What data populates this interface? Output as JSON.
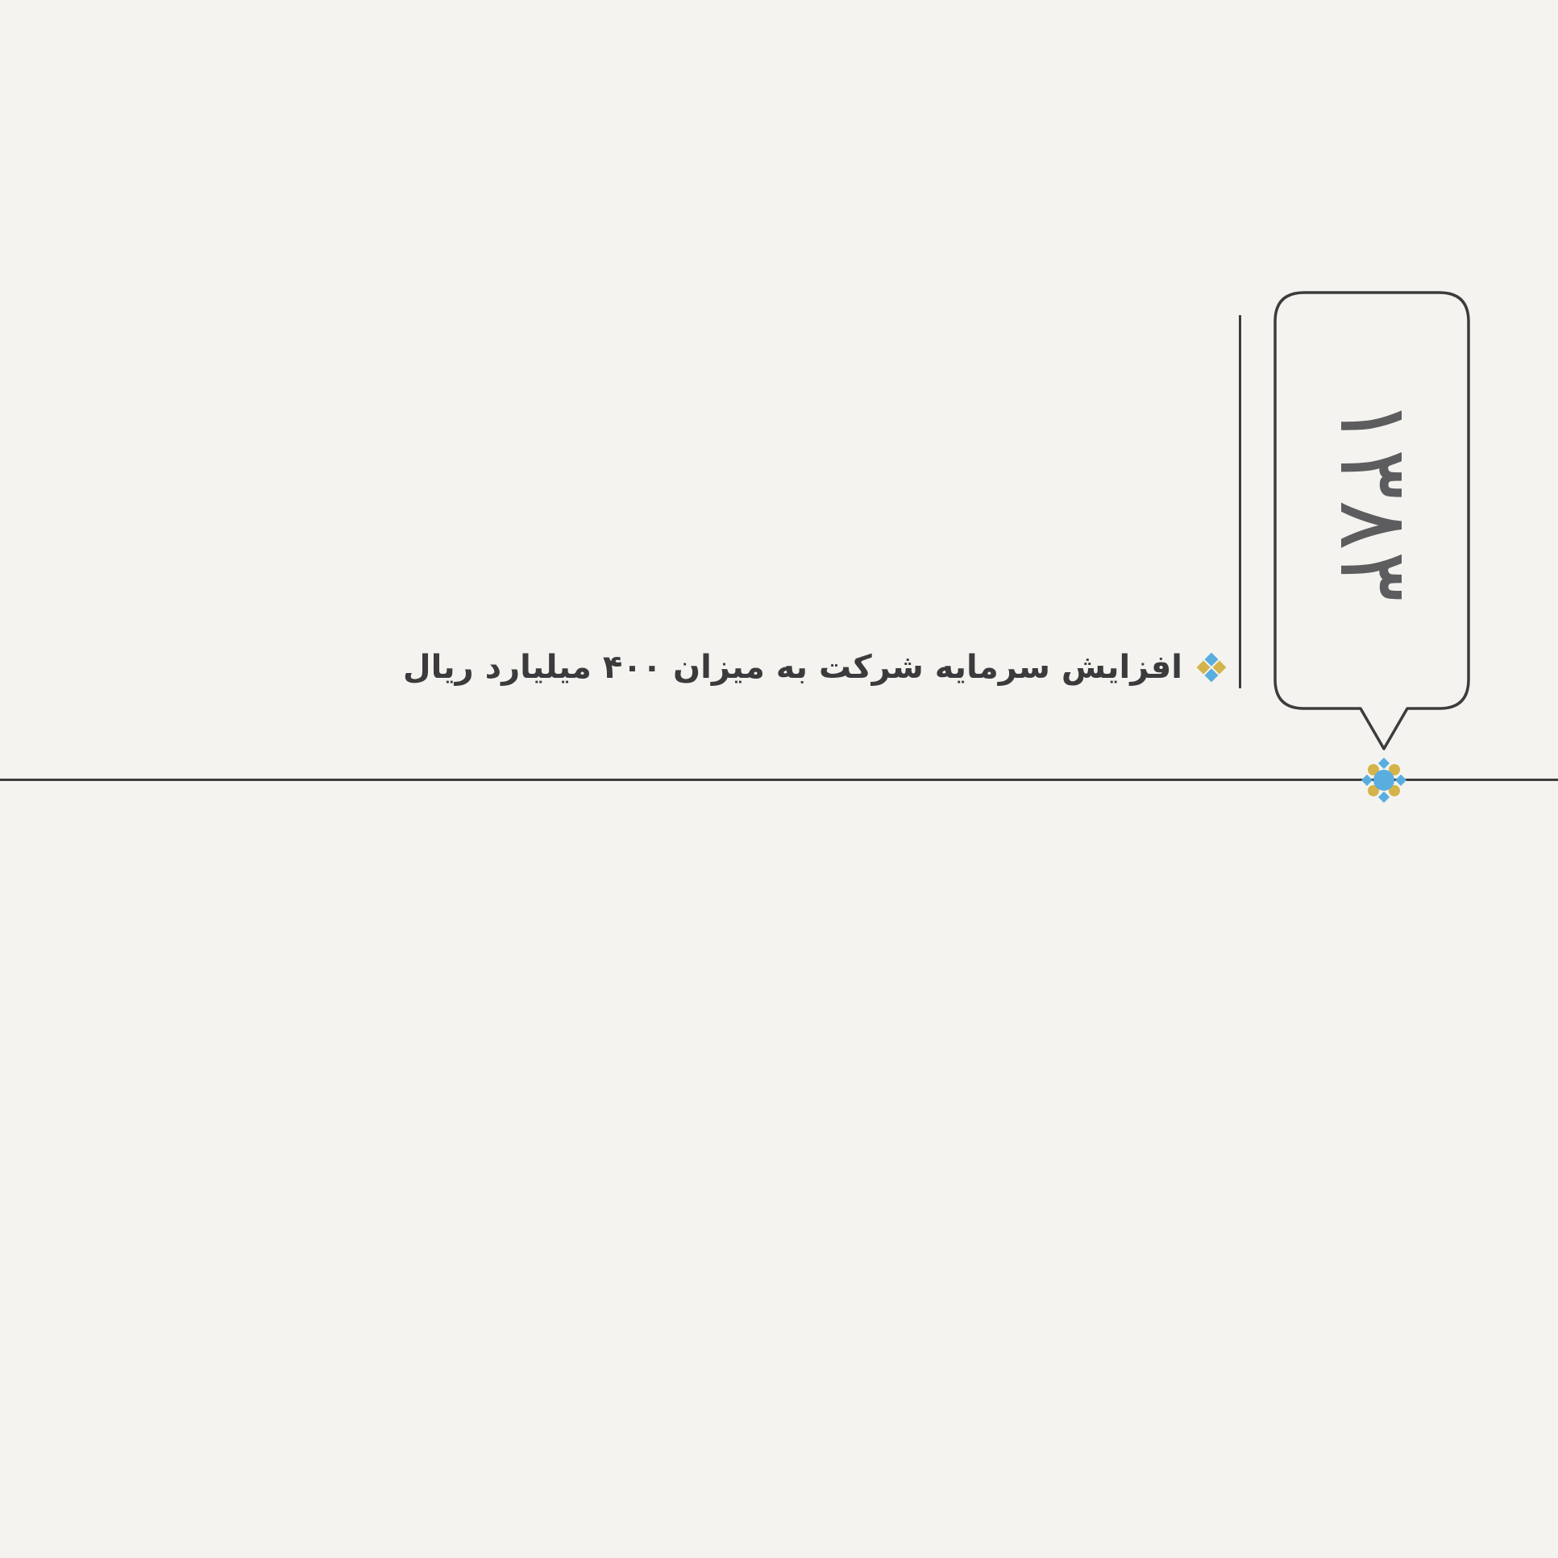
{
  "timeline": {
    "entries": [
      {
        "year": "۱۳۸۳",
        "event": "افزایش سرمایه شرکت به میزان ۴۰۰ میلیارد ریال"
      }
    ]
  },
  "colors": {
    "background": "#f4f3ef",
    "line": "#3c3c3c",
    "year_text": "#5d5d5f",
    "event_text": "#3b3b3d",
    "accent_blue": "#5aaedf",
    "accent_gold": "#d4b44a"
  },
  "icons": {
    "bullet": "diamond-quad-icon",
    "node": "flower-node-icon"
  }
}
